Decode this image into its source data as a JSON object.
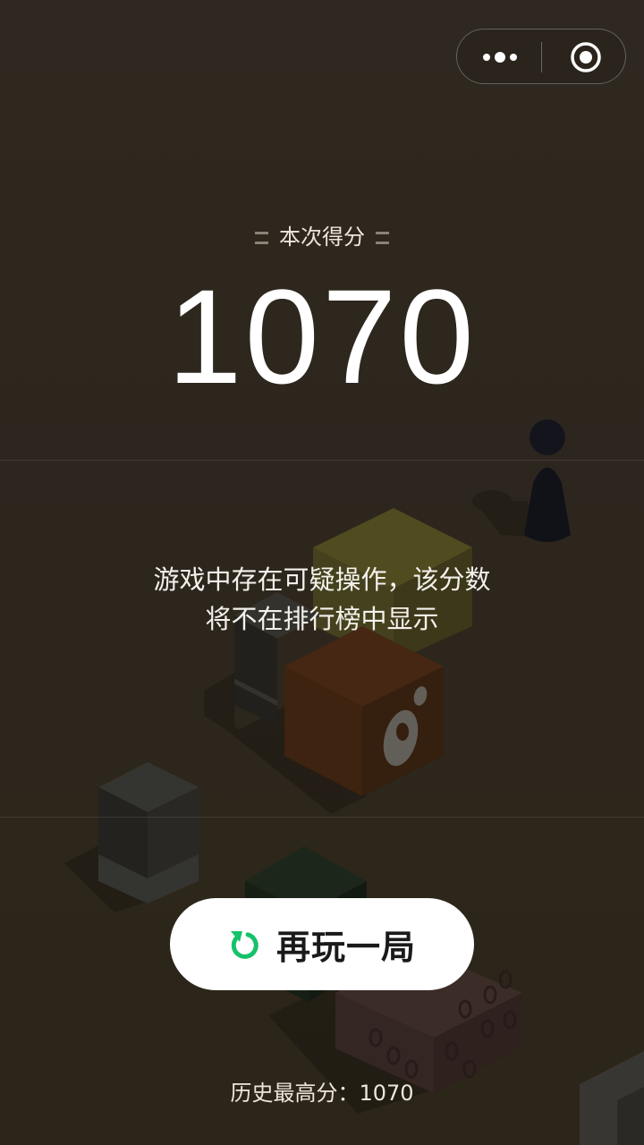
{
  "top_bar": {
    "more_icon": "more-dots-icon",
    "close_icon": "target-circle-icon"
  },
  "result": {
    "score_label": "本次得分",
    "score_value": "1070",
    "warning_line1": "游戏中存在可疑操作，该分数",
    "warning_line2": "将不在排行榜中显示"
  },
  "actions": {
    "replay_label": "再玩一局",
    "replay_icon": "refresh-icon"
  },
  "footer": {
    "best_score_label": "历史最高分：",
    "best_score_value": "1070"
  },
  "colors": {
    "background": "#3c3328",
    "accent_green": "#15c26b",
    "button_bg": "#ffffff",
    "text_primary": "#ffffff"
  }
}
